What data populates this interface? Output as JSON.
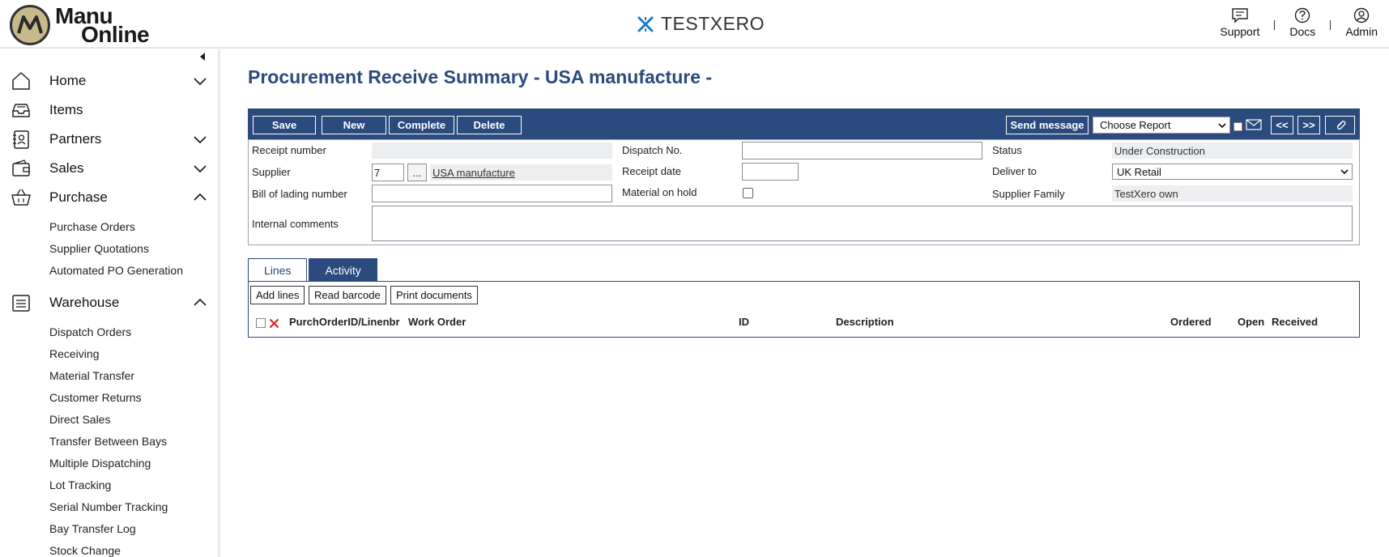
{
  "header": {
    "logo_line1": "Manu",
    "logo_line2": "Online",
    "company": "TESTXERO",
    "support": "Support",
    "docs": "Docs",
    "admin": "Admin",
    "separator": "|"
  },
  "sidebar": {
    "sections": [
      {
        "label": "Home",
        "icon": "home-icon",
        "chevron": "down"
      },
      {
        "label": "Items",
        "icon": "inbox-icon",
        "chevron": "none"
      },
      {
        "label": "Partners",
        "icon": "contacts-icon",
        "chevron": "down"
      },
      {
        "label": "Sales",
        "icon": "wallet-icon",
        "chevron": "down"
      },
      {
        "label": "Purchase",
        "icon": "basket-icon",
        "chevron": "up"
      },
      {
        "label": "Warehouse",
        "icon": "warehouse-icon",
        "chevron": "up"
      }
    ],
    "purchase_items": [
      "Purchase Orders",
      "Supplier Quotations",
      "Automated PO Generation"
    ],
    "warehouse_items": [
      "Dispatch Orders",
      "Receiving",
      "Material Transfer",
      "Customer Returns",
      "Direct Sales",
      "Transfer Between Bays",
      "Multiple Dispatching",
      "Lot Tracking",
      "Serial Number Tracking",
      "Bay Transfer Log",
      "Stock Change"
    ]
  },
  "page": {
    "title": "Procurement Receive Summary - USA manufacture -"
  },
  "toolbar": {
    "save": "Save",
    "new": "New",
    "complete": "Complete",
    "delete": "Delete",
    "send_message": "Send message",
    "choose_report": "Choose Report",
    "prev": "<<",
    "next": ">>"
  },
  "form": {
    "receipt_number_label": "Receipt number",
    "receipt_number": "",
    "supplier_label": "Supplier",
    "supplier_id": "7",
    "supplier_browse": "...",
    "supplier_name": "USA manufacture",
    "bill_label": "Bill of lading number",
    "bill_value": "",
    "internal_comments_label": "Internal comments",
    "internal_comments": "",
    "dispatch_label": "Dispatch No.",
    "dispatch_value": "",
    "receipt_date_label": "Receipt date",
    "receipt_date": "",
    "material_hold_label": "Material on hold",
    "material_hold": false,
    "status_label": "Status",
    "status_value": "Under Construction",
    "deliver_label": "Deliver to",
    "deliver_value": "UK Retail",
    "family_label": "Supplier Family",
    "family_value": "TestXero own"
  },
  "tabs": {
    "lines": "Lines",
    "activity": "Activity",
    "active": "Activity"
  },
  "lines": {
    "add_lines": "Add lines",
    "read_barcode": "Read barcode",
    "print_documents": "Print documents",
    "columns": [
      "PurchOrderID/Linenbr",
      "Work Order",
      "ID",
      "Description",
      "Ordered",
      "Open",
      "Received"
    ]
  },
  "colors": {
    "accent": "#2b4a7d",
    "title": "#2c4a7c",
    "brand_icon": "#1b7bc7",
    "delete_x": "#d0281e"
  }
}
